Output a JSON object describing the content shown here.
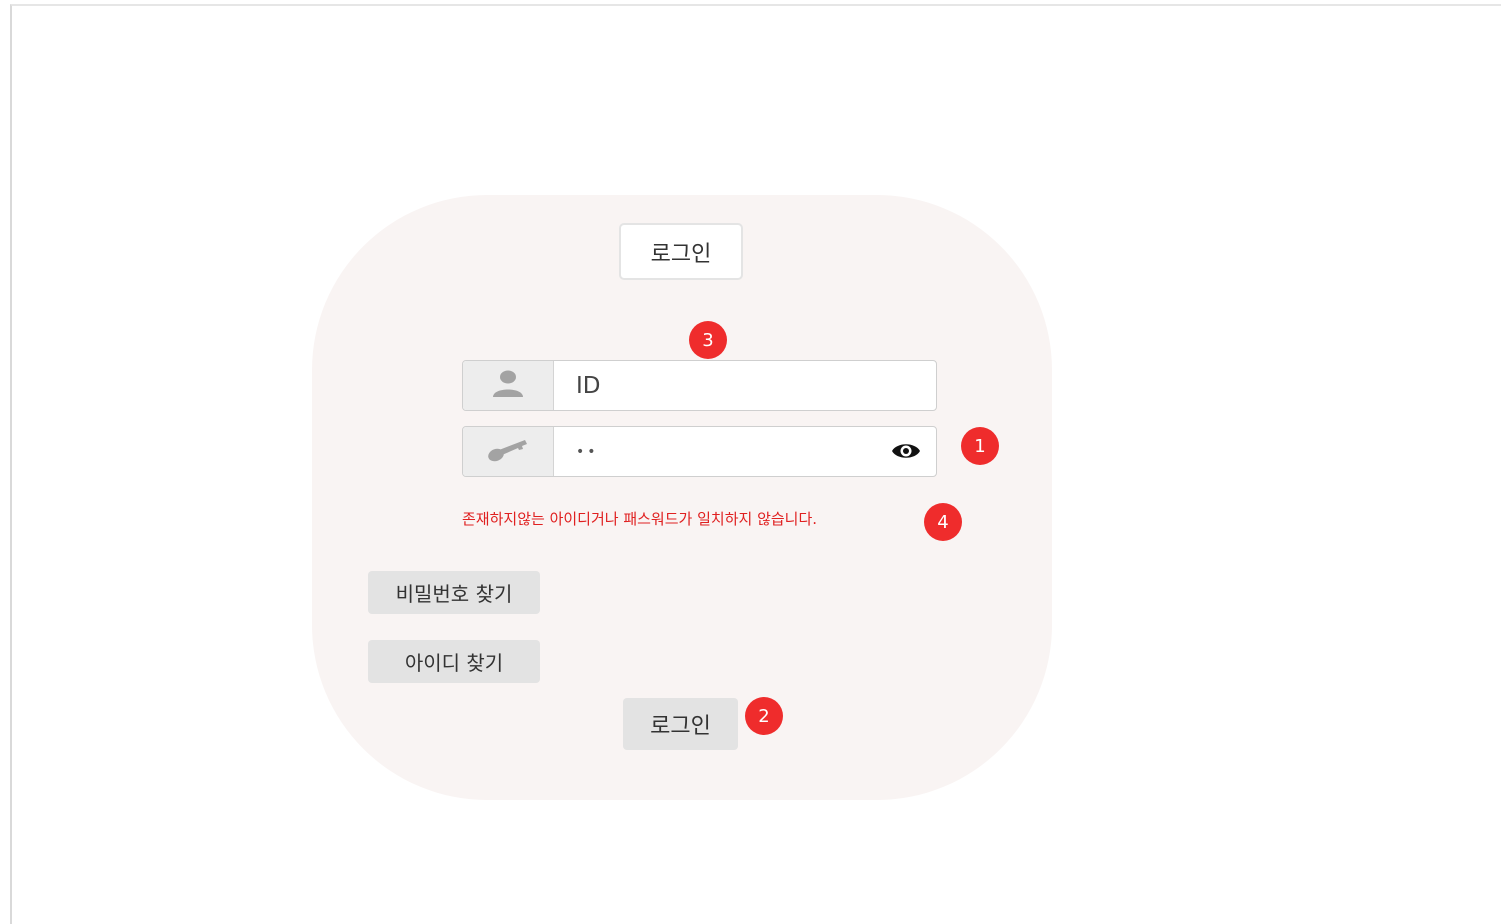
{
  "login_card": {
    "title": "로그인",
    "id_field": {
      "value": "ID",
      "icon": "user-icon"
    },
    "password_field": {
      "value": "••",
      "icon": "key-icon",
      "toggle_icon": "eye-icon"
    },
    "error_message": "존재하지않는 아이디거나 패스워드가 일치하지 않습니다.",
    "find_password_label": "비밀번호 찾기",
    "find_id_label": "아이디 찾기",
    "login_button_label": "로그인"
  },
  "annotations": {
    "badge_1": "1",
    "badge_2": "2",
    "badge_3": "3",
    "badge_4": "4"
  },
  "colors": {
    "card_background": "#f9f4f3",
    "badge": "#ef2c2c",
    "error_text": "#e02020",
    "button_gray": "#e3e3e3"
  }
}
